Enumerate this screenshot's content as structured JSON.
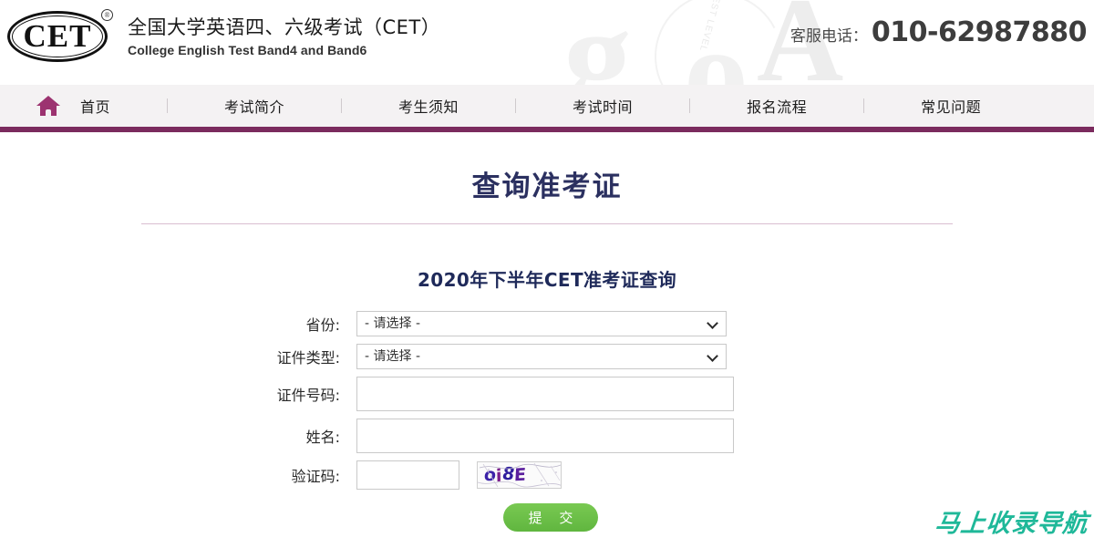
{
  "header": {
    "logo_text": "CET",
    "logo_registered": "®",
    "title_cn": "全国大学英语四、六级考试（CET）",
    "title_en": "College English Test Band4 and Band6",
    "hotline_label": "客服电话：",
    "hotline_number": "010-62987880",
    "watermark": {
      "letter_a": "A",
      "letter_g": "g",
      "letter_o": "o",
      "arc_text": "SAT VS TEST LEVEL"
    }
  },
  "nav": {
    "home_icon": "home-icon",
    "items": [
      {
        "label": "首页"
      },
      {
        "label": "考试简介"
      },
      {
        "label": "考生须知"
      },
      {
        "label": "考试时间"
      },
      {
        "label": "报名流程"
      },
      {
        "label": "常见问题"
      }
    ]
  },
  "main": {
    "page_title": "查询准考证",
    "form_subtitle": "2020年下半年CET准考证查询",
    "fields": {
      "province": {
        "label": "省份:",
        "value": "- 请选择 -",
        "options": [
          "- 请选择 -"
        ]
      },
      "id_type": {
        "label": "证件类型:",
        "value": "- 请选择 -",
        "options": [
          "- 请选择 -"
        ]
      },
      "id_number": {
        "label": "证件号码:",
        "value": "",
        "placeholder": ""
      },
      "name": {
        "label": "姓名:",
        "value": "",
        "placeholder": ""
      },
      "captcha": {
        "label": "验证码:",
        "value": "",
        "placeholder": "",
        "image_text": "oi8E"
      }
    },
    "submit_label": "提 交"
  },
  "corner_watermark": {
    "text": "马上收录导航"
  },
  "colors": {
    "nav_bar_bottom": "#7b2b5e",
    "nav_background": "#f4f2f3",
    "home_icon": "#9c3370",
    "title": "#2b3060",
    "subtitle": "#1f2a5a",
    "divider": "#d9bed0",
    "submit_button": "#6bbf4a",
    "captcha_text": "#3b22a8",
    "corner_watermark": "#1fb899"
  }
}
